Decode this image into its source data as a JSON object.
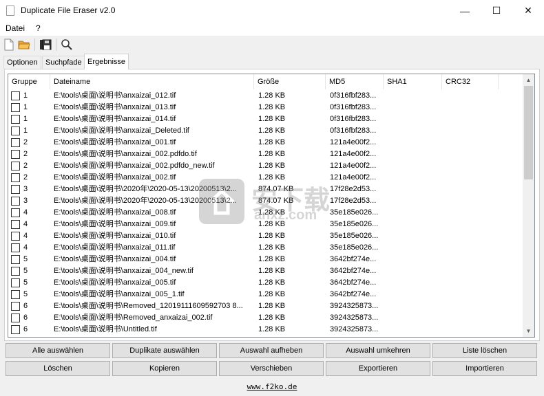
{
  "window": {
    "title": "Duplicate File Eraser v2.0",
    "controls": {
      "minimize": "—",
      "maximize": "☐",
      "close": "✕"
    }
  },
  "menu": [
    "Datei",
    "?"
  ],
  "toolbar": [
    "new-file-icon",
    "open-folder-icon",
    "save-icon",
    "search-icon"
  ],
  "tabs": [
    {
      "label": "Optionen",
      "active": false
    },
    {
      "label": "Suchpfade",
      "active": false
    },
    {
      "label": "Ergebnisse",
      "active": true
    }
  ],
  "table": {
    "columns": [
      "Gruppe",
      "Dateiname",
      "Größe",
      "MD5",
      "SHA1",
      "CRC32"
    ],
    "rows": [
      [
        "1",
        "E:\\tools\\桌面\\说明书\\anxaizai_012.tif",
        "1.28 KB",
        "0f316fbf283..."
      ],
      [
        "1",
        "E:\\tools\\桌面\\说明书\\anxaizai_013.tif",
        "1.28 KB",
        "0f316fbf283..."
      ],
      [
        "1",
        "E:\\tools\\桌面\\说明书\\anxaizai_014.tif",
        "1.28 KB",
        "0f316fbf283..."
      ],
      [
        "1",
        "E:\\tools\\桌面\\说明书\\anxaizai_Deleted.tif",
        "1.28 KB",
        "0f316fbf283..."
      ],
      [
        "2",
        "E:\\tools\\桌面\\说明书\\anxaizai_001.tif",
        "1.28 KB",
        "121a4e00f2..."
      ],
      [
        "2",
        "E:\\tools\\桌面\\说明书\\anxaizai_002.pdfdo.tif",
        "1.28 KB",
        "121a4e00f2..."
      ],
      [
        "2",
        "E:\\tools\\桌面\\说明书\\anxaizai_002.pdfdo_new.tif",
        "1.28 KB",
        "121a4e00f2..."
      ],
      [
        "2",
        "E:\\tools\\桌面\\说明书\\anxaizai_002.tif",
        "1.28 KB",
        "121a4e00f2..."
      ],
      [
        "3",
        "E:\\tools\\桌面\\说明书\\2020年\\2020-05-13\\20200513\\2...",
        "874.07 KB",
        "17f28e2d53..."
      ],
      [
        "3",
        "E:\\tools\\桌面\\说明书\\2020年\\2020-05-13\\20200513\\2...",
        "874.07 KB",
        "17f28e2d53..."
      ],
      [
        "4",
        "E:\\tools\\桌面\\说明书\\anxaizai_008.tif",
        "1.28 KB",
        "35e185e026..."
      ],
      [
        "4",
        "E:\\tools\\桌面\\说明书\\anxaizai_009.tif",
        "1.28 KB",
        "35e185e026..."
      ],
      [
        "4",
        "E:\\tools\\桌面\\说明书\\anxaizai_010.tif",
        "1.28 KB",
        "35e185e026..."
      ],
      [
        "4",
        "E:\\tools\\桌面\\说明书\\anxaizai_011.tif",
        "1.28 KB",
        "35e185e026..."
      ],
      [
        "5",
        "E:\\tools\\桌面\\说明书\\anxaizai_004.tif",
        "1.28 KB",
        "3642bf274e..."
      ],
      [
        "5",
        "E:\\tools\\桌面\\说明书\\anxaizai_004_new.tif",
        "1.28 KB",
        "3642bf274e..."
      ],
      [
        "5",
        "E:\\tools\\桌面\\说明书\\anxaizai_005.tif",
        "1.28 KB",
        "3642bf274e..."
      ],
      [
        "5",
        "E:\\tools\\桌面\\说明书\\anxaizai_005_1.tif",
        "1.28 KB",
        "3642bf274e..."
      ],
      [
        "6",
        "E:\\tools\\桌面\\说明书\\Removed_12019111609592703 8...",
        "1.28 KB",
        "3924325873..."
      ],
      [
        "6",
        "E:\\tools\\桌面\\说明书\\Removed_anxaizai_002.tif",
        "1.28 KB",
        "3924325873..."
      ],
      [
        "6",
        "E:\\tools\\桌面\\说明书\\Untitled.tif",
        "1.28 KB",
        "3924325873..."
      ]
    ]
  },
  "buttons_row1": [
    "Alle auswählen",
    "Duplikate auswählen",
    "Auswahl aufheben",
    "Auswahl umkehren",
    "Liste löschen"
  ],
  "buttons_row2": [
    "Löschen",
    "Kopieren",
    "Verschieben",
    "Exportieren",
    "Importieren"
  ],
  "footer": {
    "link": "www.f2ko.de"
  },
  "watermark": {
    "text": "安下载",
    "subtext": "anxz.com"
  }
}
